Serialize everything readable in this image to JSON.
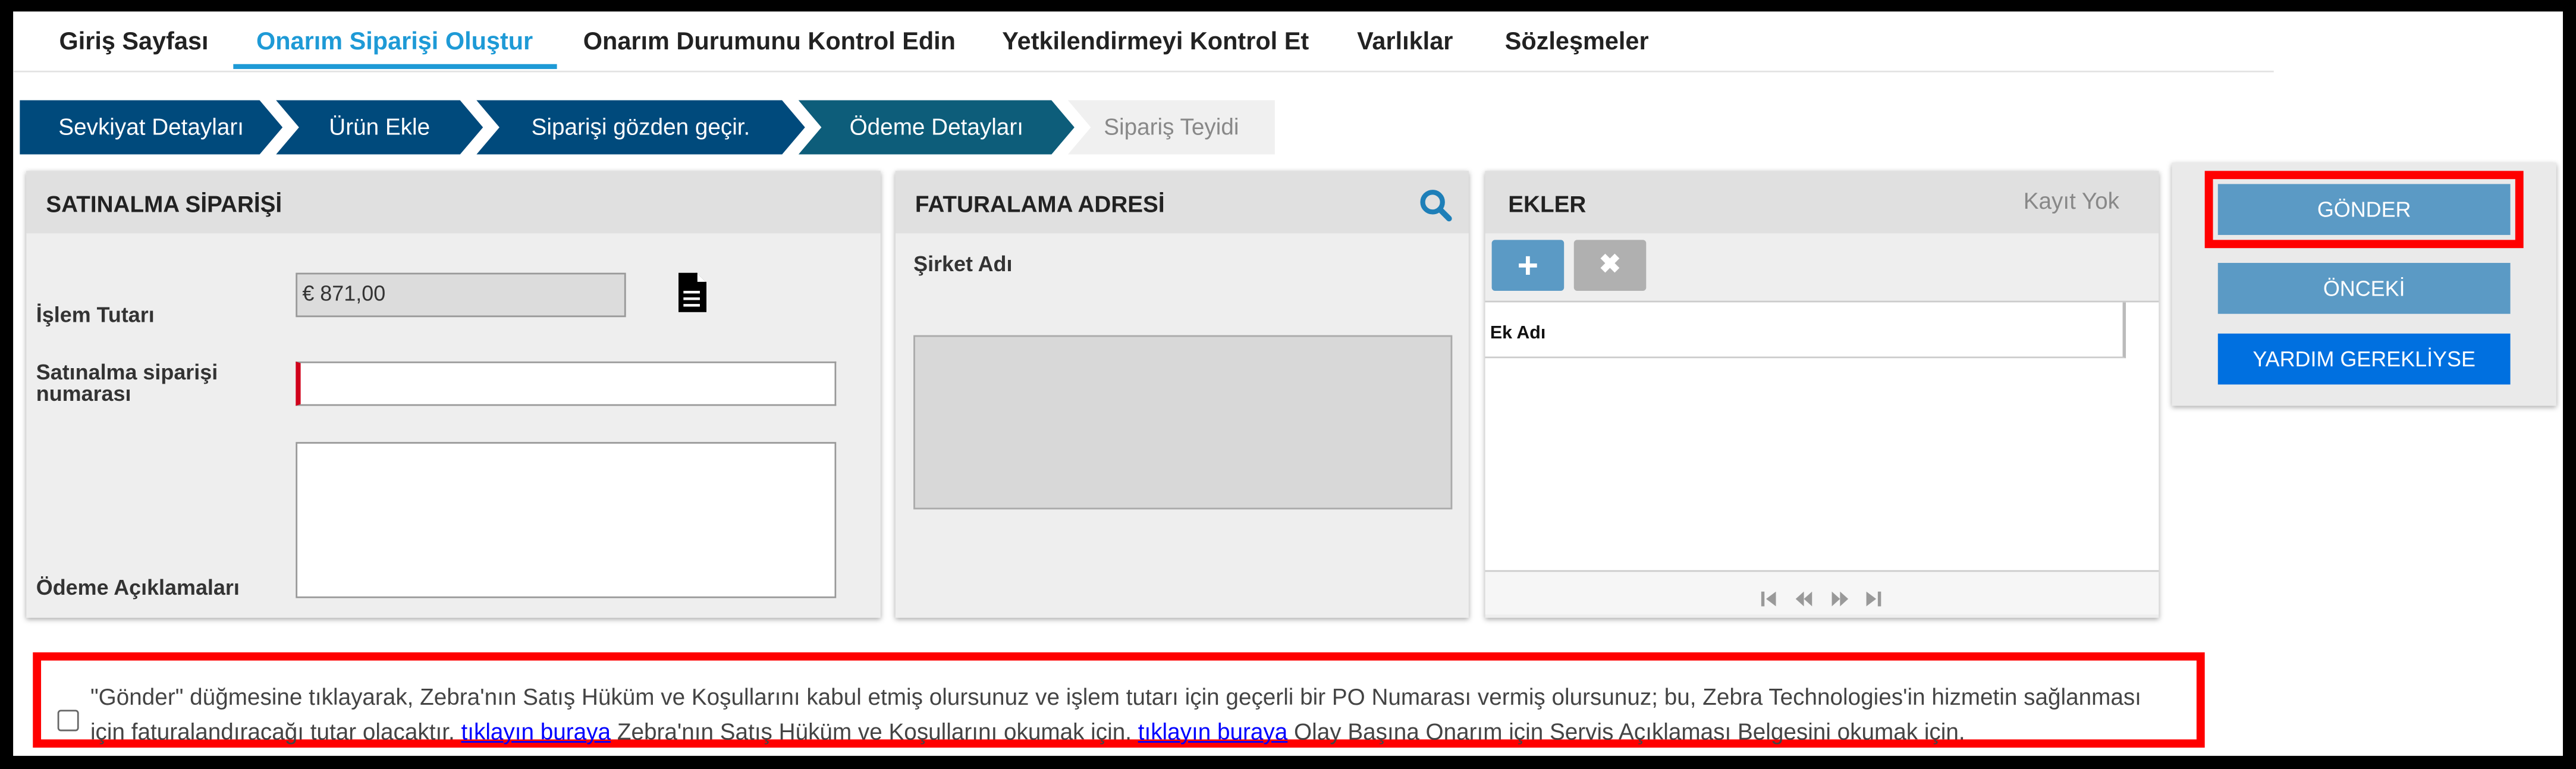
{
  "nav": {
    "items": [
      "Giriş Sayfası",
      "Onarım Siparişi Oluştur",
      "Onarım Durumunu Kontrol Edin",
      "Yetkilendirmeyi Kontrol Et",
      "Varlıklar",
      "Sözleşmeler"
    ],
    "active_index": 1
  },
  "steps": [
    "Sevkiyat Detayları",
    "Ürün Ekle",
    "Siparişi gözden geçir.",
    "Ödeme Detayları",
    "Sipariş Teyidi"
  ],
  "purchase_order": {
    "title": "SATINALMA SİPARİŞİ",
    "amount_label": "İşlem Tutarı",
    "amount_value": "€ 871,00",
    "po_number_label": "Satınalma siparişi numarası",
    "po_number_value": "",
    "payment_notes_label": "Ödeme Açıklamaları",
    "payment_notes_value": ""
  },
  "billing": {
    "title": "FATURALAMA ADRESİ",
    "company_label": "Şirket Adı",
    "address_value": ""
  },
  "attachments": {
    "title": "EKLER",
    "status": "Kayıt Yok",
    "column_header": "Ek Adı",
    "add_symbol": "+",
    "remove_symbol": "✖"
  },
  "actions": {
    "submit_label": "GÖNDER",
    "previous_label": "ÖNCEKİ",
    "help_label": "YARDIM GEREKLİYSE"
  },
  "terms": {
    "text_part1": "\"Gönder\" düğmesine tıklayarak, Zebra'nın Satış Hüküm ve Koşullarını kabul etmiş olursunuz ve işlem tutarı için geçerli bir PO Numarası vermiş olursunuz; bu, Zebra Technologies'in hizmetin sağlanması için faturalandıracağı tutar olacaktır. ",
    "link1": "tıklayın buraya",
    "text_part2": " Zebra'nın Satış Hüküm ve Koşullarını okumak için. ",
    "link2": "tıklayın buraya",
    "text_part3": " Olay Başına Onarım için Servis Açıklaması Belgesini okumak için."
  },
  "colors": {
    "accent": "#1e9ad6",
    "step_dark": "#004a7c",
    "step_active": "#0d5d7a",
    "button_blue": "#5b9ac5",
    "help_blue": "#0070e0",
    "highlight_red": "#ff0000"
  }
}
